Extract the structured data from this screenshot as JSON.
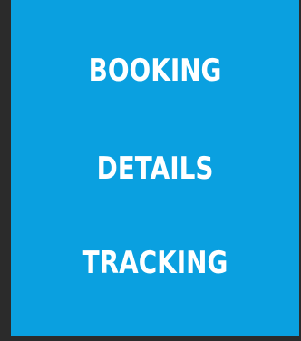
{
  "menu": {
    "items": [
      {
        "label": "BOOKING"
      },
      {
        "label": "DETAILS"
      },
      {
        "label": "TRACKING"
      }
    ]
  },
  "colors": {
    "panel_background": "#0aa0e0",
    "frame_background": "#2b2b2b",
    "text": "#ffffff"
  }
}
